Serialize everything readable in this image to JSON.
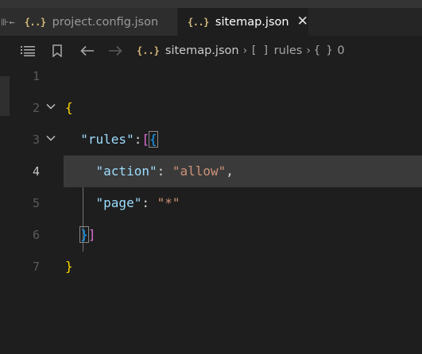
{
  "tabs": [
    {
      "label": "project.config.json",
      "icon": "{..}",
      "active": false
    },
    {
      "label": "sitemap.json",
      "icon": "{..}",
      "active": true
    }
  ],
  "breadcrumb": {
    "file": "sitemap.json",
    "file_icon": "{..}",
    "rules_symbol": "[ ]",
    "rules": "rules",
    "obj_symbol": "{ }",
    "index": "0"
  },
  "line_numbers": [
    "1",
    "2",
    "3",
    "4",
    "5",
    "6",
    "7"
  ],
  "code": {
    "l2_open": "{",
    "l3_key": "\"rules\"",
    "l3_colon": ":",
    "l3_bracket": "[",
    "l3_brace": "{",
    "l4_key": "\"action\"",
    "l4_colon": ": ",
    "l4_val": "\"allow\"",
    "l4_comma": ",",
    "l5_key": "\"page\"",
    "l5_colon": ": ",
    "l5_val": "\"*\"",
    "l6_brace": "}",
    "l6_bracket": "]",
    "l7_close": "}"
  },
  "colors": {
    "key": "#9cdcfe",
    "string": "#ce9178",
    "bracket_level1": "#ffd700",
    "bracket_level2": "#da70d6",
    "bracket_level3": "#179fff",
    "json_icon": "#d7ba7d"
  }
}
